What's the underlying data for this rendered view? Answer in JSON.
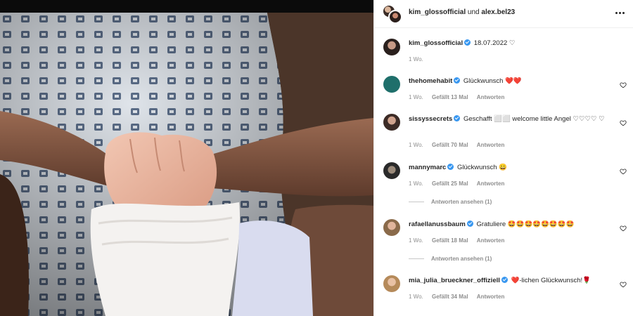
{
  "post": {
    "header": {
      "author": "kim_glossofficial",
      "connector": "und",
      "coauthor": "alex.bel23"
    },
    "caption": {
      "username": "kim_glossofficial",
      "text": "18.07.2022 ♡",
      "age": "1 Wo."
    }
  },
  "comments": [
    {
      "username": "thehomehabit",
      "text": "Glückwunsch ❤️❤️",
      "age": "1 Wo.",
      "likes": "Gefällt 13 Mal",
      "reply": "Antworten"
    },
    {
      "username": "sissyssecrets",
      "text": "Geschafft ⬜⬜ welcome little Angel ♡♡♡♡ ♡",
      "age": "1 Wo.",
      "likes": "Gefällt 70 Mal",
      "reply": "Antworten"
    },
    {
      "username": "mannymarc",
      "text": "Glückwunsch 😀",
      "age": "1 Wo.",
      "likes": "Gefällt 25 Mal",
      "reply": "Antworten",
      "view_replies": "Antworten ansehen (1)"
    },
    {
      "username": "rafaellanussbaum",
      "text": "Gratuliere 🤩🤩🤩🤩🤩🤩🤩🤩",
      "age": "1 Wo.",
      "likes": "Gefällt 18 Mal",
      "reply": "Antworten",
      "view_replies": "Antworten ansehen (1)"
    },
    {
      "username": "mia_julia_brueckner_offiziell",
      "text": "❤️-lichen Glückwunsch!🌹",
      "age": "1 Wo.",
      "likes": "Gefällt 34 Mal",
      "reply": "Antworten"
    }
  ],
  "icons": {
    "more": "more-options-icon",
    "like": "heart-outline-icon",
    "verified": "verified-badge-icon"
  },
  "colors": {
    "accent": "#3897f0",
    "text": "#262626",
    "muted": "#8e8e8e"
  }
}
